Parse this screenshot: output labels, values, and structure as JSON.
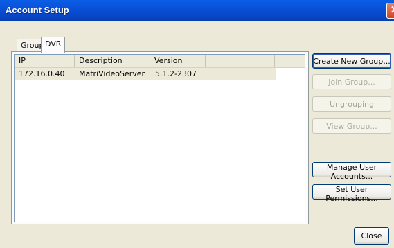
{
  "window": {
    "title": "Account Setup",
    "close_glyph": "✕"
  },
  "tabs": [
    {
      "label": "Group"
    },
    {
      "label": "DVR"
    }
  ],
  "table": {
    "columns": [
      "IP",
      "Description",
      "Version"
    ],
    "rows": [
      {
        "ip": "172.16.0.40",
        "description": "MatriVideoServer",
        "version": "5.1.2-2307"
      }
    ]
  },
  "buttons": {
    "create_new_group": "Create New Group...",
    "join_group": "Join Group...",
    "ungrouping": "Ungrouping",
    "view_group": "View Group...",
    "manage_user_accounts": "Manage User Accounts...",
    "set_user_permissions": "Set User Permissions...",
    "close": "Close"
  }
}
